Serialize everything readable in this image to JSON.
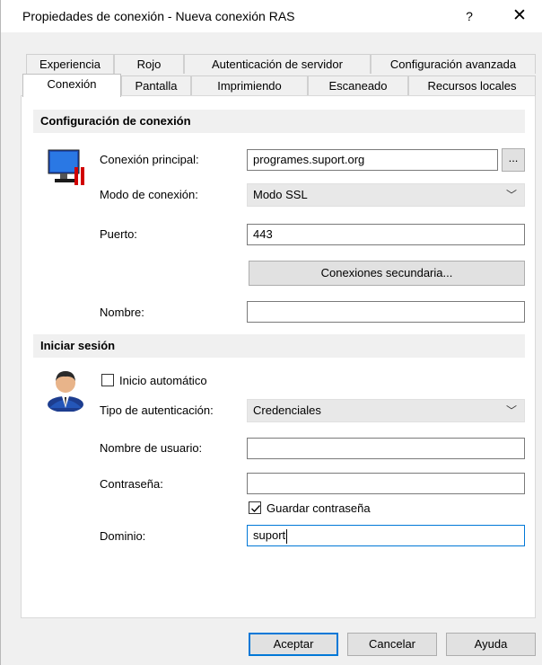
{
  "window": {
    "title": "Propiedades de conexión - Nueva conexión RAS",
    "help_glyph": "?",
    "close_glyph": "✕"
  },
  "tabs_back": [
    {
      "label": "Experiencia"
    },
    {
      "label": "Rojo"
    },
    {
      "label": "Autenticación de servidor"
    },
    {
      "label": "Configuración avanzada"
    }
  ],
  "tabs_front": [
    {
      "label": "Conexión",
      "active": true
    },
    {
      "label": "Pantalla"
    },
    {
      "label": "Imprimiendo"
    },
    {
      "label": "Escaneado"
    },
    {
      "label": "Recursos locales"
    }
  ],
  "connection_section": {
    "title": "Configuración de conexión",
    "icon": "monitor-icon",
    "primary_label": "Conexión principal:",
    "primary_value": "programes.suport.org",
    "browse_label": "...",
    "mode_label": "Modo de conexión:",
    "mode_value": "Modo SSL",
    "port_label": "Puerto:",
    "port_value": "443",
    "secondary_button": "Conexiones secundaria...",
    "name_label": "Nombre:",
    "name_value": ""
  },
  "login_section": {
    "title": "Iniciar sesión",
    "icon": "user-icon",
    "auto_login_label": "Inicio automático",
    "auto_login_checked": false,
    "auth_type_label": "Tipo de autenticación:",
    "auth_type_value": "Credenciales",
    "username_label": "Nombre de usuario:",
    "username_value": "",
    "password_label": "Contraseña:",
    "password_value": "",
    "save_password_label": "Guardar contraseña",
    "save_password_checked": true,
    "domain_label": "Dominio:",
    "domain_value": "suport"
  },
  "footer": {
    "accept": "Aceptar",
    "cancel": "Cancelar",
    "help": "Ayuda"
  },
  "colors": {
    "accent": "#0078d7",
    "window_bg": "#f0f0f0",
    "panel_bg": "#ffffff"
  }
}
